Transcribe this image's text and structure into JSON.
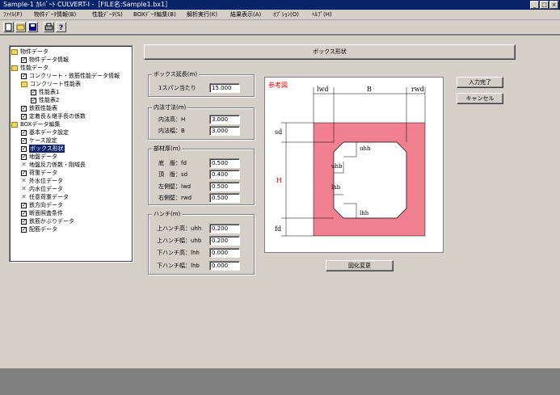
{
  "window": {
    "title": "Sample-1 ｶﾙﾊﾞｰﾄ CULVERT-Ⅰ -［FILE名:Sample1.bx1］",
    "controls": [
      "_",
      "□",
      "×"
    ]
  },
  "menu": [
    "ﾌｧｲﾙ(F)",
    "物件ﾃﾞｰﾀ情報(B)",
    "性能ﾃﾞｰﾀ(S)",
    "BOXﾃﾞｰﾀ編集(B)",
    "解析実行(K)",
    "結果表示(A)",
    "ｵﾌﾟｼｮﾝ(O)",
    "ﾍﾙﾌﾟ(H)"
  ],
  "tree": [
    {
      "label": "物件データ",
      "type": "folder"
    },
    {
      "label": "物件データ情報",
      "type": "check"
    },
    {
      "label": "性能データ",
      "type": "folder"
    },
    {
      "label": "コンクリート・鉄筋性能データ情報",
      "type": "check"
    },
    {
      "label": "コンクリート性能表",
      "type": "folder"
    },
    {
      "label": "性能表1",
      "type": "check"
    },
    {
      "label": "性能表2",
      "type": "check"
    },
    {
      "label": "鉄筋性能表",
      "type": "check"
    },
    {
      "label": "定着長＆継手長の係数",
      "type": "check"
    },
    {
      "label": "BOXデータ編集",
      "type": "folder"
    },
    {
      "label": "基本データ設定",
      "type": "check"
    },
    {
      "label": "ケース設定",
      "type": "check"
    },
    {
      "label": "ボックス形状",
      "type": "check",
      "selected": true
    },
    {
      "label": "地盤データ",
      "type": "check"
    },
    {
      "label": "地盤反力係数・剛域長",
      "type": "x"
    },
    {
      "label": "荷重データ",
      "type": "check"
    },
    {
      "label": "外水位データ",
      "type": "x"
    },
    {
      "label": "内水位データ",
      "type": "x"
    },
    {
      "label": "任意荷重データ",
      "type": "x"
    },
    {
      "label": "鉄方向データ",
      "type": "check"
    },
    {
      "label": "断面照査条件",
      "type": "check"
    },
    {
      "label": "鉄筋かぶりデータ",
      "type": "check"
    },
    {
      "label": "配筋データ",
      "type": "check"
    }
  ],
  "panel_title": "ボックス形状",
  "span": {
    "title": "ボックス延長(m)",
    "label": "1スパン当たり",
    "value": "15.000"
  },
  "inner": {
    "title": "内法寸法(m)",
    "h_label": "内法高：H",
    "h_value": "3.000",
    "b_label": "内法幅：B",
    "b_value": "3.000"
  },
  "thick": {
    "title": "部材厚(m)",
    "fd_label": "底　版：fd",
    "fd_value": "0.500",
    "sd_label": "頂　版：sd",
    "sd_value": "0.400",
    "lwd_label": "左側壁：lwd",
    "lwd_value": "0.500",
    "rwd_label": "右側壁：rwd",
    "rwd_value": "0.500"
  },
  "haunch": {
    "title": "ハンチ(m)",
    "uhh_label": "上ハンチ高：uhh",
    "uhh_value": "0.200",
    "uhb_label": "上ハンチ幅：uhb",
    "uhb_value": "0.200",
    "lhh_label": "下ハンチ高：lhh",
    "lhh_value": "0.000",
    "lhb_label": "下ハンチ幅：lhb",
    "lhb_value": "0.000"
  },
  "ref": {
    "title": "参考図",
    "lwd": "lwd",
    "B": "B",
    "rwd": "rwd",
    "sd": "sd",
    "fd": "fd",
    "H": "H",
    "uhh": "uhh",
    "uhb": "uhb",
    "lhb": "lhb",
    "lhh": "lhh"
  },
  "buttons": {
    "ok": "入力完了",
    "cancel": "キャンセル",
    "redraw": "図化変更"
  },
  "colors": {
    "box_fill": "#f08090",
    "titlebar": "#0a246a",
    "face": "#d4d0c8"
  }
}
